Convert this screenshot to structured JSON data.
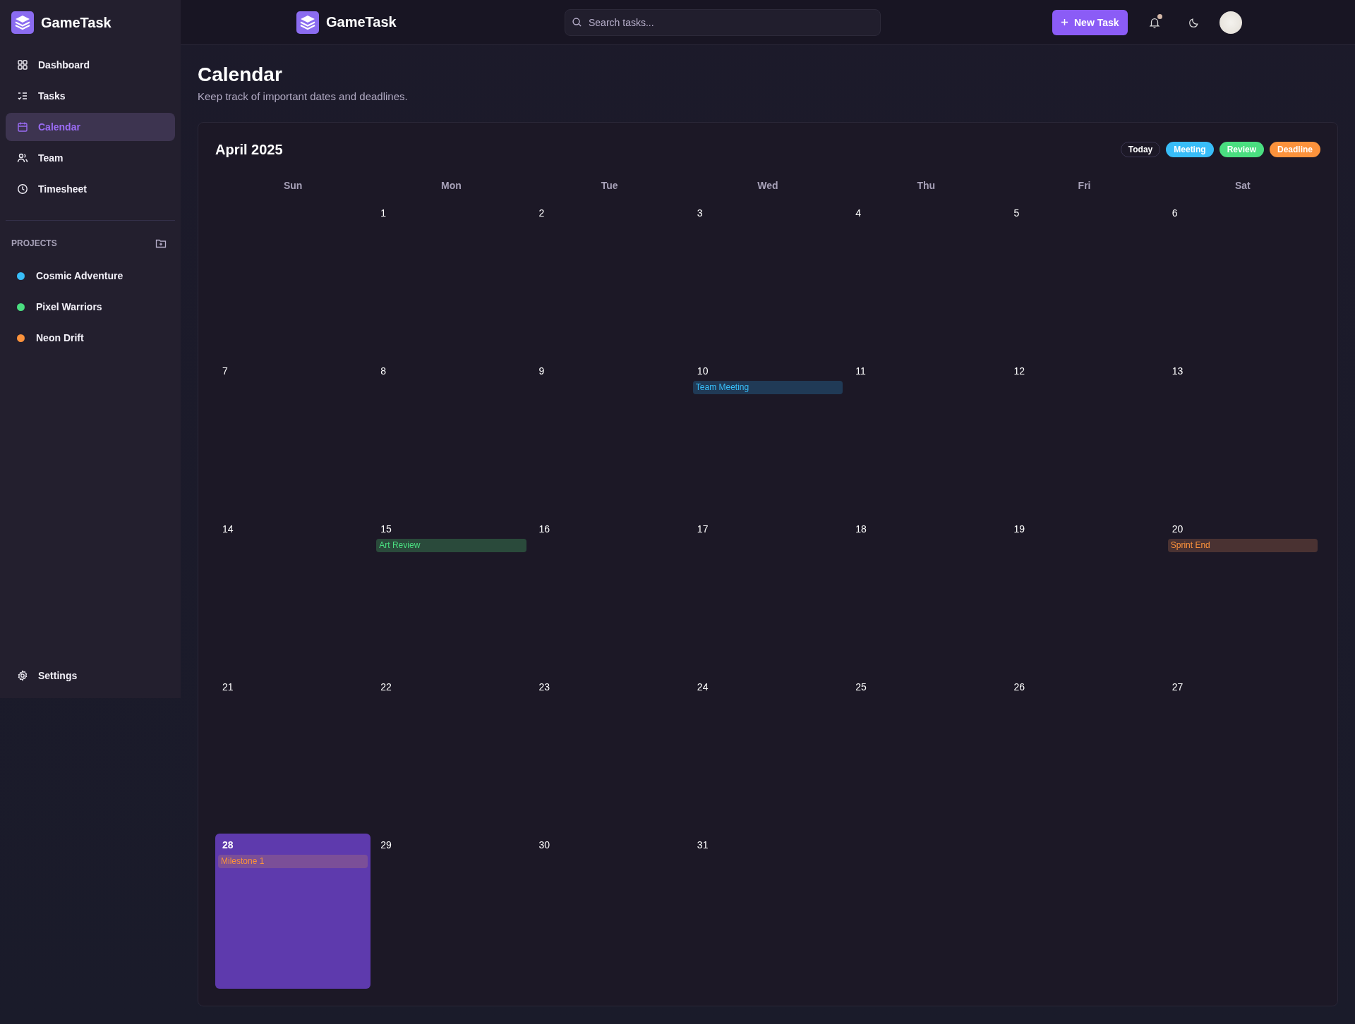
{
  "sidebar": {
    "brand": "GameTask",
    "nav": [
      {
        "label": "Dashboard",
        "selected": false
      },
      {
        "label": "Tasks",
        "selected": false
      },
      {
        "label": "Calendar",
        "selected": true
      },
      {
        "label": "Team",
        "selected": false
      },
      {
        "label": "Timesheet",
        "selected": false
      }
    ],
    "projects_heading": "PROJECTS",
    "projects": [
      {
        "name": "Cosmic Adventure",
        "color": "#38bdf8"
      },
      {
        "name": "Pixel Warriors",
        "color": "#4ade80"
      },
      {
        "name": "Neon Drift",
        "color": "#fb923c"
      }
    ],
    "settings": "Settings"
  },
  "topbar": {
    "brand": "GameTask",
    "search": {
      "placeholder": "Search tasks..."
    },
    "new_task": "New Task",
    "notification_dot": true
  },
  "page": {
    "title": "Calendar",
    "subtitle": "Keep track of important dates and deadlines."
  },
  "calendar": {
    "month": "April 2025",
    "legend": [
      {
        "label": "Today",
        "kind": "today"
      },
      {
        "label": "Meeting",
        "kind": "meeting"
      },
      {
        "label": "Review",
        "kind": "review"
      },
      {
        "label": "Deadline",
        "kind": "deadline"
      }
    ],
    "weekdays": [
      "Sun",
      "Mon",
      "Tue",
      "Wed",
      "Thu",
      "Fri",
      "Sat"
    ],
    "leading_blank": true,
    "days": [
      {
        "day": "1",
        "today": false
      },
      {
        "day": "2",
        "today": false
      },
      {
        "day": "3",
        "today": false
      },
      {
        "day": "4",
        "today": false
      },
      {
        "day": "5",
        "today": false
      },
      {
        "day": "6",
        "today": false
      },
      {
        "day": "7",
        "today": false
      },
      {
        "day": "8",
        "today": false
      },
      {
        "day": "9",
        "today": false
      },
      {
        "day": "10",
        "today": false,
        "events": [
          {
            "title": "Team Meeting",
            "kind": "meeting"
          }
        ]
      },
      {
        "day": "11",
        "today": false
      },
      {
        "day": "12",
        "today": false
      },
      {
        "day": "13",
        "today": false
      },
      {
        "day": "14",
        "today": false
      },
      {
        "day": "15",
        "today": false,
        "events": [
          {
            "title": "Art Review",
            "kind": "review"
          }
        ]
      },
      {
        "day": "16",
        "today": false
      },
      {
        "day": "17",
        "today": false
      },
      {
        "day": "18",
        "today": false
      },
      {
        "day": "19",
        "today": false
      },
      {
        "day": "20",
        "today": false,
        "events": [
          {
            "title": "Sprint End",
            "kind": "deadline"
          }
        ]
      },
      {
        "day": "21",
        "today": false
      },
      {
        "day": "22",
        "today": false
      },
      {
        "day": "23",
        "today": false
      },
      {
        "day": "24",
        "today": false
      },
      {
        "day": "25",
        "today": false
      },
      {
        "day": "26",
        "today": false
      },
      {
        "day": "27",
        "today": false
      },
      {
        "day": "28",
        "today": true,
        "events": [
          {
            "title": "Milestone 1",
            "kind": "deadline"
          }
        ]
      },
      {
        "day": "29",
        "today": false
      },
      {
        "day": "30",
        "today": false
      },
      {
        "day": "31",
        "today": false
      }
    ]
  }
}
